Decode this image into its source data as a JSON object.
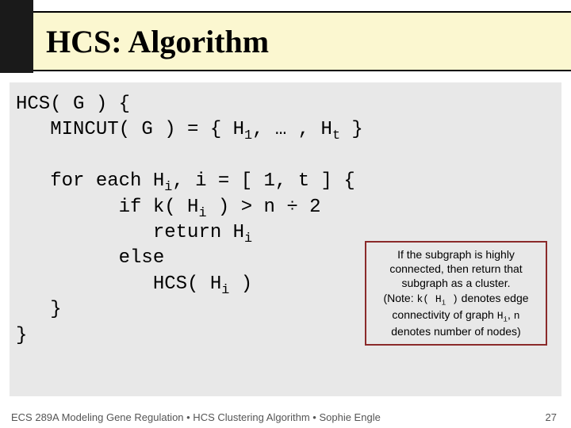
{
  "header": {
    "title": "HCS: Algorithm"
  },
  "code": {
    "line1a": "HCS( G ) {",
    "line2a": "   MINCUT( G ) = { H",
    "line2b": ", … , H",
    "line2c": " }",
    "blank": "",
    "line3a": "   for each H",
    "line3b": ", i = [ 1, t ] {",
    "line4a": "         if k( H",
    "line4b": " ) > n ÷ 2",
    "line5a": "            return H",
    "line6a": "         else",
    "line7a": "            HCS( H",
    "line7b": " )",
    "line8a": "   }",
    "line9a": "}",
    "sub1": "1",
    "subt": "t",
    "subi": "i"
  },
  "note": {
    "l1": "If the subgraph is highly",
    "l2": "connected, then return that",
    "l3": "subgraph as a cluster.",
    "l4a": "(Note: ",
    "l4_mono_a": "k( H",
    "l4_mono_sub": "i",
    "l4_mono_b": " )",
    "l4b": " denotes edge",
    "l5a": "connectivity of graph ",
    "l5_mono_a": "H",
    "l5_mono_sub": "i",
    "l5b": ", ",
    "l5_mono_n": "n",
    "l6": "denotes number of nodes)"
  },
  "footer": {
    "left": "ECS 289A Modeling Gene Regulation • HCS Clustering Algorithm • Sophie Engle",
    "right": "27"
  }
}
